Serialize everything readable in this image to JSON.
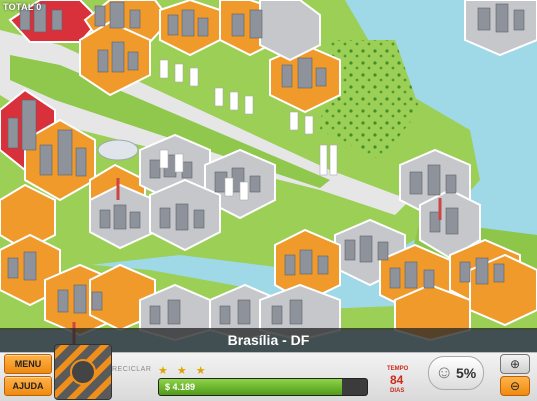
{
  "hud": {
    "total_label": "TOTAL 0",
    "city_title": "Brasília - DF",
    "menu_label": "MENU",
    "help_label": "AJUDA",
    "recycle_label": "RECICLAR",
    "money_text": "$ 4.189",
    "money_level": 0.88,
    "stars_count": 3,
    "tempo_label": "TEMPO",
    "tempo_value": "84",
    "dias_label": "DIAS",
    "happiness_value": "5%"
  },
  "icons": {
    "happy": "smiley-icon",
    "zoom_in": "zoom-in-icon",
    "zoom_out": "zoom-out-icon"
  },
  "colors": {
    "water": "#9fd9e8",
    "grass": "#9ccf55",
    "hex_orange": "#f09a2b",
    "hex_gray": "#c5c7cb",
    "hex_red": "#d9313c",
    "button_orange": "#f08a10",
    "accent_red": "#cc2a1c"
  }
}
